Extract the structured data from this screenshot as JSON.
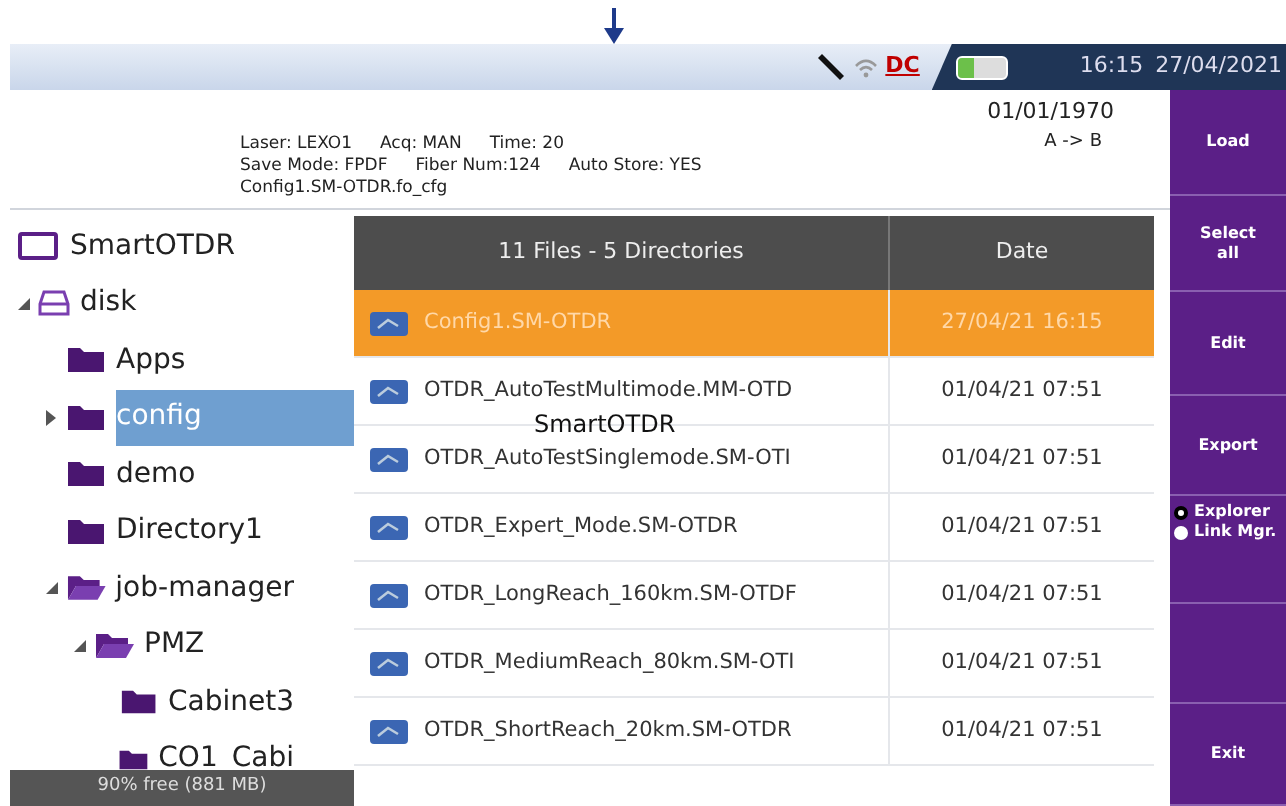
{
  "status_bar": {
    "power_label": "DC",
    "time": "16:15",
    "date": "27/04/2021"
  },
  "info": {
    "lines": [
      [
        "Laser: LEXO1",
        "Acq: MAN",
        "Time: 20"
      ],
      [
        "Save Mode: FPDF",
        "Fiber Num:124",
        "Auto Store: YES"
      ],
      [
        "Config1.SM-OTDR.fo_cfg"
      ]
    ],
    "date": "01/01/1970",
    "direction": "A -> B"
  },
  "tree": {
    "items": [
      {
        "kind": "computer",
        "label": "SmartOTDR",
        "selected": false
      },
      {
        "kind": "drive",
        "label": "disk",
        "selected": false,
        "expanded": true,
        "children": [
          {
            "kind": "folder",
            "label": "Apps",
            "selected": false
          },
          {
            "kind": "folder",
            "label": "config",
            "selected": true,
            "expanded": false
          },
          {
            "kind": "folder",
            "label": "demo",
            "selected": false
          },
          {
            "kind": "folder",
            "label": "Directory1",
            "selected": false
          },
          {
            "kind": "folder",
            "label": "job-manager",
            "selected": false,
            "expanded": true,
            "children": [
              {
                "kind": "folder",
                "label": "PMZ",
                "selected": false,
                "expanded": true,
                "children": [
                  {
                    "kind": "folder",
                    "label": "Cabinet3",
                    "selected": false
                  },
                  {
                    "kind": "folder",
                    "label": "CO1_Cabi",
                    "selected": false
                  }
                ]
              }
            ]
          }
        ]
      }
    ],
    "free_space": "90% free (881 MB)"
  },
  "table": {
    "columns": [
      "11 Files - 5 Directories",
      "Date"
    ],
    "rows": [
      {
        "name": "Config1.SM-OTDR",
        "date": "27/04/21 16:15",
        "selected": true
      },
      {
        "name": "OTDR_AutoTestMultimode.MM-OTD",
        "date": "01/04/21 07:51",
        "selected": false
      },
      {
        "name": "OTDR_AutoTestSinglemode.SM-OTI",
        "date": "01/04/21 07:51",
        "selected": false
      },
      {
        "name": "OTDR_Expert_Mode.SM-OTDR",
        "date": "01/04/21 07:51",
        "selected": false
      },
      {
        "name": "OTDR_LongReach_160km.SM-OTDF",
        "date": "01/04/21 07:51",
        "selected": false
      },
      {
        "name": "OTDR_MediumReach_80km.SM-OTI",
        "date": "01/04/21 07:51",
        "selected": false
      },
      {
        "name": "OTDR_ShortReach_20km.SM-OTDR",
        "date": "01/04/21 07:51",
        "selected": false
      }
    ],
    "tooltip": "SmartOTDR"
  },
  "side_buttons": [
    {
      "kind": "button",
      "label": "Load"
    },
    {
      "kind": "button",
      "label": "Select all"
    },
    {
      "kind": "button",
      "label": "Edit"
    },
    {
      "kind": "button",
      "label": "Export"
    },
    {
      "kind": "radio",
      "options": [
        {
          "label": "Explorer",
          "selected": true
        },
        {
          "label": "Link Mgr.",
          "selected": false
        }
      ]
    },
    {
      "kind": "blank"
    },
    {
      "kind": "button",
      "label": "Exit"
    }
  ]
}
